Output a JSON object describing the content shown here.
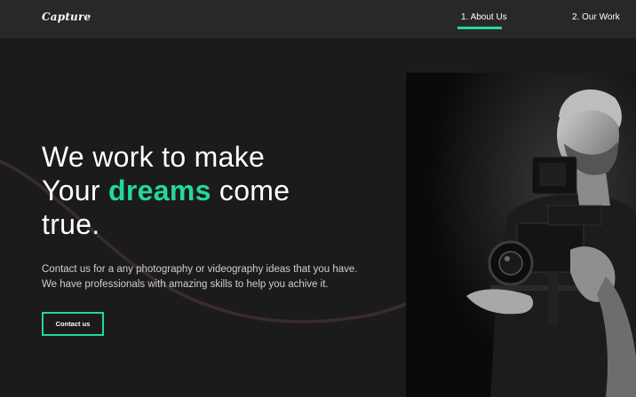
{
  "nav": {
    "logo": "Capture",
    "links": [
      {
        "label": "1. About Us",
        "active": true
      },
      {
        "label": "2. Our Work",
        "active": false
      }
    ]
  },
  "hero": {
    "title_line1": "We work to make",
    "title_line2_pre": "Your ",
    "title_accent": "dreams",
    "title_line2_post": " come",
    "title_line3": "true.",
    "description_line1": "Contact us for a any photography or videography ideas that you have.",
    "description_line2": "We have professionals with amazing skills to help you achive it.",
    "button_label": "Contact us"
  },
  "colors": {
    "accent": "#23d997",
    "background": "#1b1b1b",
    "nav_background": "#282828",
    "wave": "#3a2a38"
  },
  "image": {
    "subject": "photographer-with-camera-rig"
  }
}
